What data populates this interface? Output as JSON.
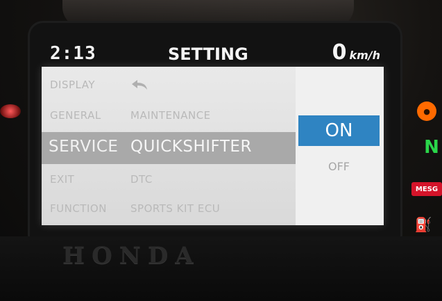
{
  "header": {
    "clock": "2:13",
    "title": "SETTING",
    "speed_value": "0",
    "speed_unit": "km/h"
  },
  "menu": {
    "back_icon": "back-arrow-icon",
    "rows": [
      {
        "category": "DISPLAY",
        "item": ""
      },
      {
        "category": "GENERAL",
        "item": "MAINTENANCE"
      },
      {
        "category": "SERVICE",
        "item": "QUICKSHIFTER"
      },
      {
        "category": "EXIT",
        "item": "DTC"
      },
      {
        "category": "FUNCTION",
        "item": "SPORTS KIT ECU"
      }
    ],
    "selected_index": 2
  },
  "options": {
    "on": "ON",
    "off": "OFF",
    "selected": "ON"
  },
  "bezel": {
    "brand": "HONDA"
  },
  "indicators": {
    "mesg": "MESG",
    "neutral": "N"
  },
  "colors": {
    "selected_option": "#2f84c2",
    "selected_row": "#a9a9a9",
    "neutral_light": "#2ad64a",
    "mesg_light": "#d4142a",
    "warning_orange": "#ff6a00"
  }
}
